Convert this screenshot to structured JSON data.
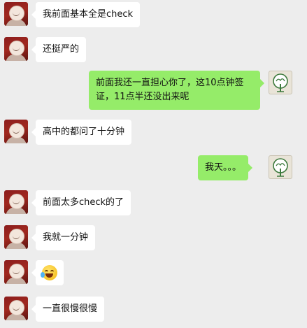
{
  "messages": [
    {
      "side": "left",
      "text": "我前面基本全是check"
    },
    {
      "side": "left",
      "text": "还挺严的"
    },
    {
      "side": "right",
      "text": "前面我还一直担心你了，这10点钟签证，11点半还没出来呢"
    },
    {
      "side": "left",
      "text": "高中的都问了十分钟"
    },
    {
      "side": "right",
      "text": "我天。。。"
    },
    {
      "side": "left",
      "text": "前面太多check的了"
    },
    {
      "side": "left",
      "text": "我就一分钟"
    },
    {
      "side": "left",
      "emoji": "laughing-crying-emoji"
    },
    {
      "side": "left",
      "text": "一直很慢很慢"
    }
  ],
  "colors": {
    "background": "#ededed",
    "left_bubble": "#ffffff",
    "right_bubble": "#95ec69"
  },
  "icons": {
    "left_avatar": "user-avatar-red",
    "right_avatar": "tree-avatar"
  }
}
